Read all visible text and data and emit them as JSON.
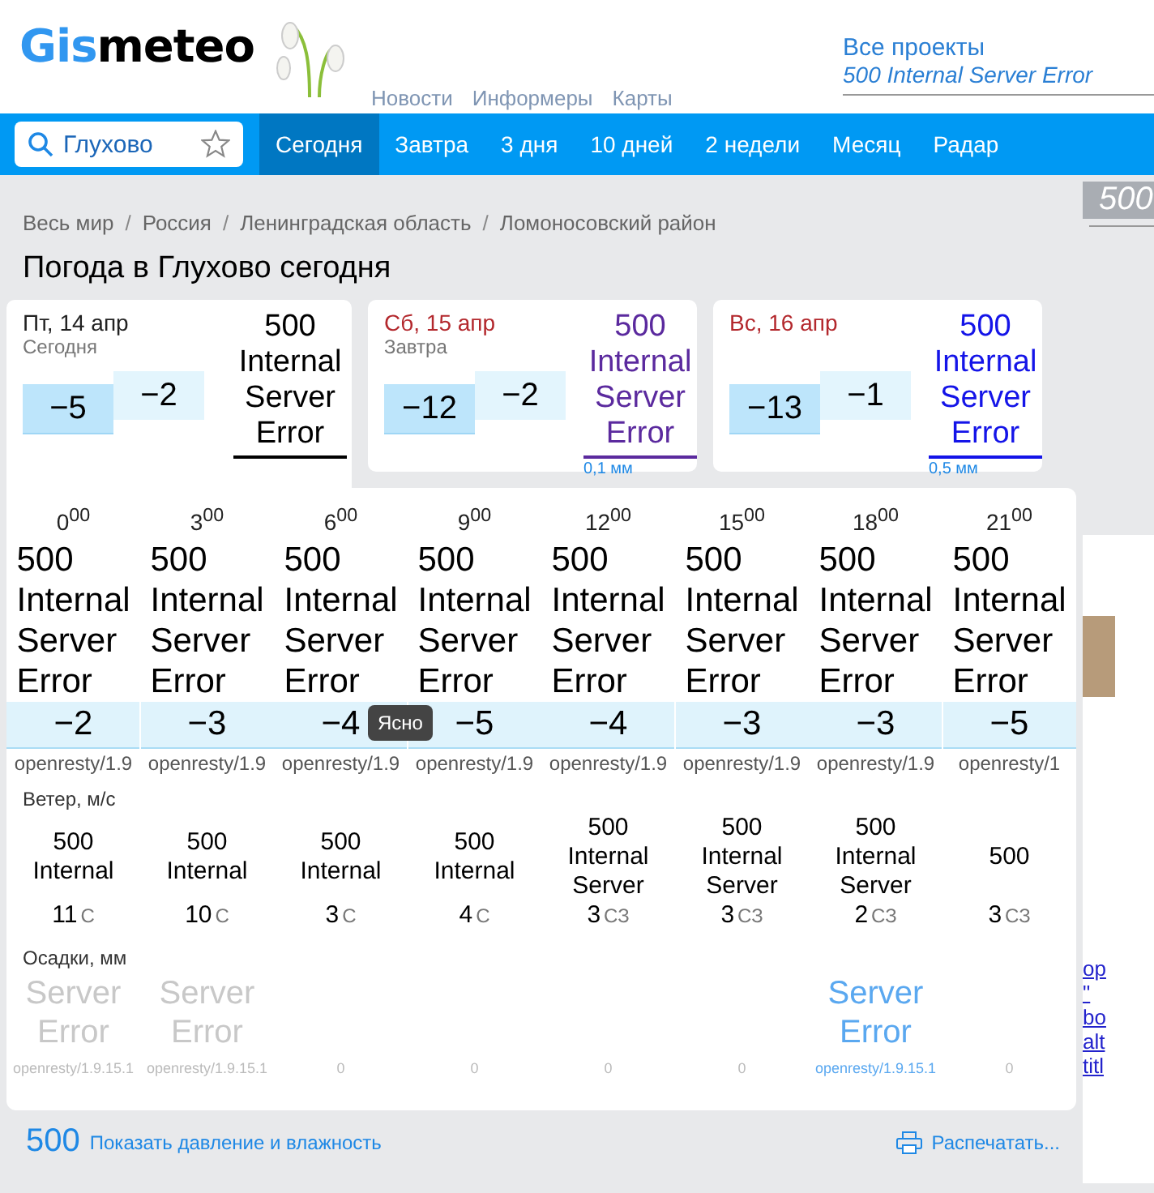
{
  "logo": {
    "part1": "Gis",
    "part2": "meteo"
  },
  "header_links": {
    "projects": "Все проекты",
    "error": "500 Internal Server Error"
  },
  "hidden_menu": [
    "Новости",
    "Информеры",
    "Карты"
  ],
  "search": {
    "value": "Глухово"
  },
  "tabs": [
    {
      "label": "Сегодня",
      "selected": true
    },
    {
      "label": "Завтра",
      "selected": false
    },
    {
      "label": "3 дня",
      "selected": false
    },
    {
      "label": "10 дней",
      "selected": false
    },
    {
      "label": "2 недели",
      "selected": false
    },
    {
      "label": "Месяц",
      "selected": false
    },
    {
      "label": "Радар",
      "selected": false
    }
  ],
  "breadcrumbs": [
    {
      "label": "Весь мир"
    },
    {
      "sep": "/",
      "label": "Россия"
    },
    {
      "sep": "/",
      "label": "Ленинградская область"
    },
    {
      "sep": "/",
      "label": "Ломоносовский район"
    }
  ],
  "page_title": "Погода в Глухово сегодня",
  "days": [
    {
      "date": "Пт, 14 апр",
      "note": "Сегодня",
      "weekend": false,
      "selected": true,
      "min": "−5",
      "max": "−2",
      "error": "500 Internal Server Error",
      "color": "#000000"
    },
    {
      "date": "Сб, 15 апр",
      "note": "Завтра",
      "weekend": true,
      "selected": false,
      "min": "−12",
      "max": "−2",
      "error": "500 Internal Server Error",
      "color": "#5b2a9e",
      "precip": "0,1 мм"
    },
    {
      "date": "Вс, 16 апр",
      "weekend": true,
      "selected": false,
      "min": "−13",
      "max": "−1",
      "error": "500 Internal Server Error",
      "color": "#1414e8",
      "precip": "0,5 мм"
    }
  ],
  "hours": [
    {
      "time": "0$^{00}$",
      "error": "500 Internal Server Error",
      "temp": "−2",
      "server": "openresty/1.9",
      "wind_error": "500 Internal",
      "wind": "11",
      "dir": "С",
      "precip_error": "Server Error",
      "color": "#c8c8c8",
      "precip": "openresty/1.9.15.1"
    },
    {
      "time": "3$^{00}$",
      "error": "500 Internal Server Error",
      "temp": "−3",
      "server": "openresty/1.9",
      "wind_error": "500 Internal",
      "wind": "10",
      "dir": "С",
      "precip_error": "Server Error",
      "color": "#c8c8c8",
      "precip": "openresty/1.9.15.1"
    },
    {
      "time": "6$^{00}$",
      "error": "500 Internal Server Error",
      "temp": "−4",
      "server": "openresty/1.9",
      "wind_error": "500 Internal",
      "wind": "3",
      "dir": "С",
      "precip": "0"
    },
    {
      "time": "9$^{00}$",
      "error": "500 Internal Server Error",
      "temp": "−5",
      "server": "openresty/1.9",
      "wind_error": "500 Internal",
      "wind": "4",
      "dir": "С",
      "precip": "0"
    },
    {
      "time": "12$^{00}$",
      "error": "500 Internal Server Error",
      "temp": "−4",
      "server": "openresty/1.9",
      "wind_error": "500 Internal Server",
      "wind": "3",
      "dir": "СЗ",
      "precip": "0"
    },
    {
      "time": "15$^{00}$",
      "error": "500 Internal Server Error",
      "temp": "−3",
      "server": "openresty/1.9",
      "wind_error": "500 Internal Server",
      "wind": "3",
      "dir": "СЗ",
      "precip": "0"
    },
    {
      "time": "18$^{00}$",
      "error": "500 Internal Server Error",
      "temp": "−3",
      "server": "openresty/1.9",
      "wind_error": "500 Internal Server",
      "wind": "2",
      "dir": "СЗ",
      "precip_error": "Server Error",
      "color": "#5aa8f0",
      "precip": "openresty/1.9.15.1"
    },
    {
      "time": "21$^{00}$",
      "error": "500 Internal Server Error",
      "temp": "−5",
      "server": "openresty/1",
      "wind_error": "500",
      "wind": "3",
      "dir": "СЗ",
      "precip": "0"
    }
  ],
  "tooltip": "Ясно",
  "wind_label": "Ветер, м/с",
  "precip_label": "Осадки, мм",
  "footer": {
    "pressure_link": "Показать давление и влажность",
    "error": "500",
    "print": "Распечатать..."
  },
  "side": {
    "error": "500",
    "links": [
      "op",
      "\"",
      "bo",
      "alt",
      "titl"
    ]
  }
}
